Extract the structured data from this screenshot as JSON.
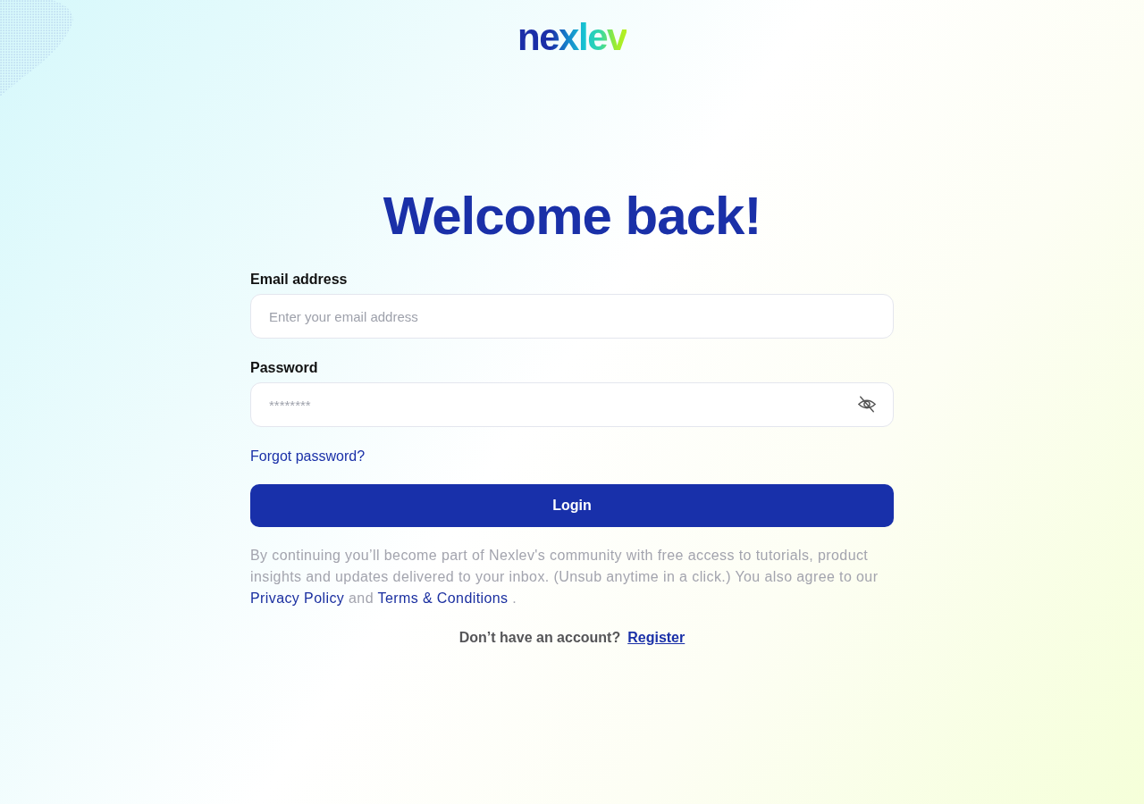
{
  "logo": {
    "text": "nexlev"
  },
  "heading": "Welcome back!",
  "fields": [
    {
      "kind": "email",
      "label": "Email address",
      "placeholder": "Enter your email address"
    },
    {
      "kind": "password",
      "label": "Password",
      "placeholder": "********",
      "show_password": false
    }
  ],
  "forgot_link": "Forgot password?",
  "login_button": "Login",
  "consent": [
    {
      "kind": "text",
      "text": "By continuing you’ll become part of Nexlev's community with free access to tutorials, product insights and updates delivered to your inbox. (Unsub anytime in a click.) You also agree to our"
    },
    {
      "kind": "link",
      "text": "Privacy Policy"
    },
    {
      "kind": "text",
      "text": "and"
    },
    {
      "kind": "link",
      "text": "Terms & Conditions"
    },
    {
      "kind": "text",
      "text": "."
    }
  ],
  "register": {
    "prompt": "Don’t have an account?",
    "link": "Register"
  }
}
